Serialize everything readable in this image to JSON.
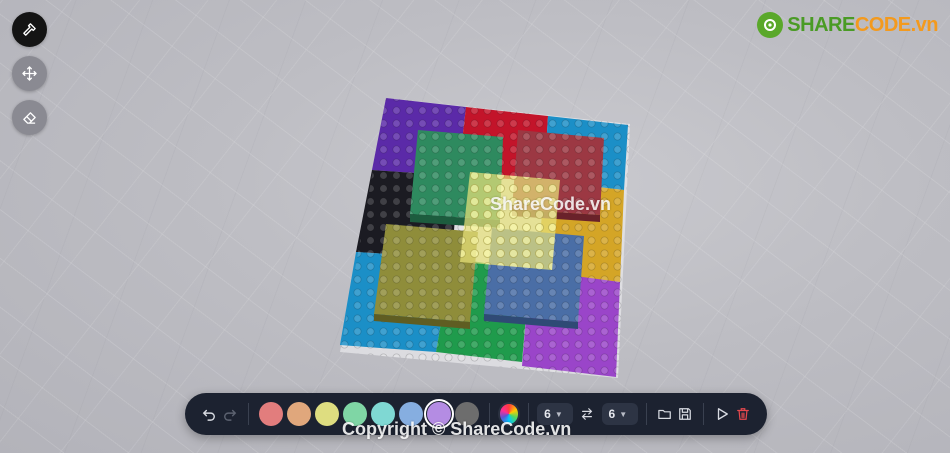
{
  "logo": {
    "part1": "SHARE",
    "part2": "CODE.vn"
  },
  "left_tools": [
    {
      "name": "build-tool-button",
      "icon": "hammer-icon",
      "active": true
    },
    {
      "name": "move-tool-button",
      "icon": "move-arrows-icon",
      "active": false
    },
    {
      "name": "erase-tool-button",
      "icon": "eraser-icon",
      "active": false
    }
  ],
  "watermark_center": "ShareCode.vn",
  "watermark_bottom": "Copyright © ShareCode.vn",
  "palette": [
    "#e27d7d",
    "#e0a77c",
    "#dedd80",
    "#7fd6a5",
    "#7fd8d3",
    "#86aee0",
    "#b48ce3",
    "#6d6d6d"
  ],
  "selected_color_index": 6,
  "size_width": "6",
  "size_depth": "6",
  "colors": {
    "toolbar_bg": "#1c2230",
    "active_tool": "#141414",
    "trash": "#e5484d"
  }
}
